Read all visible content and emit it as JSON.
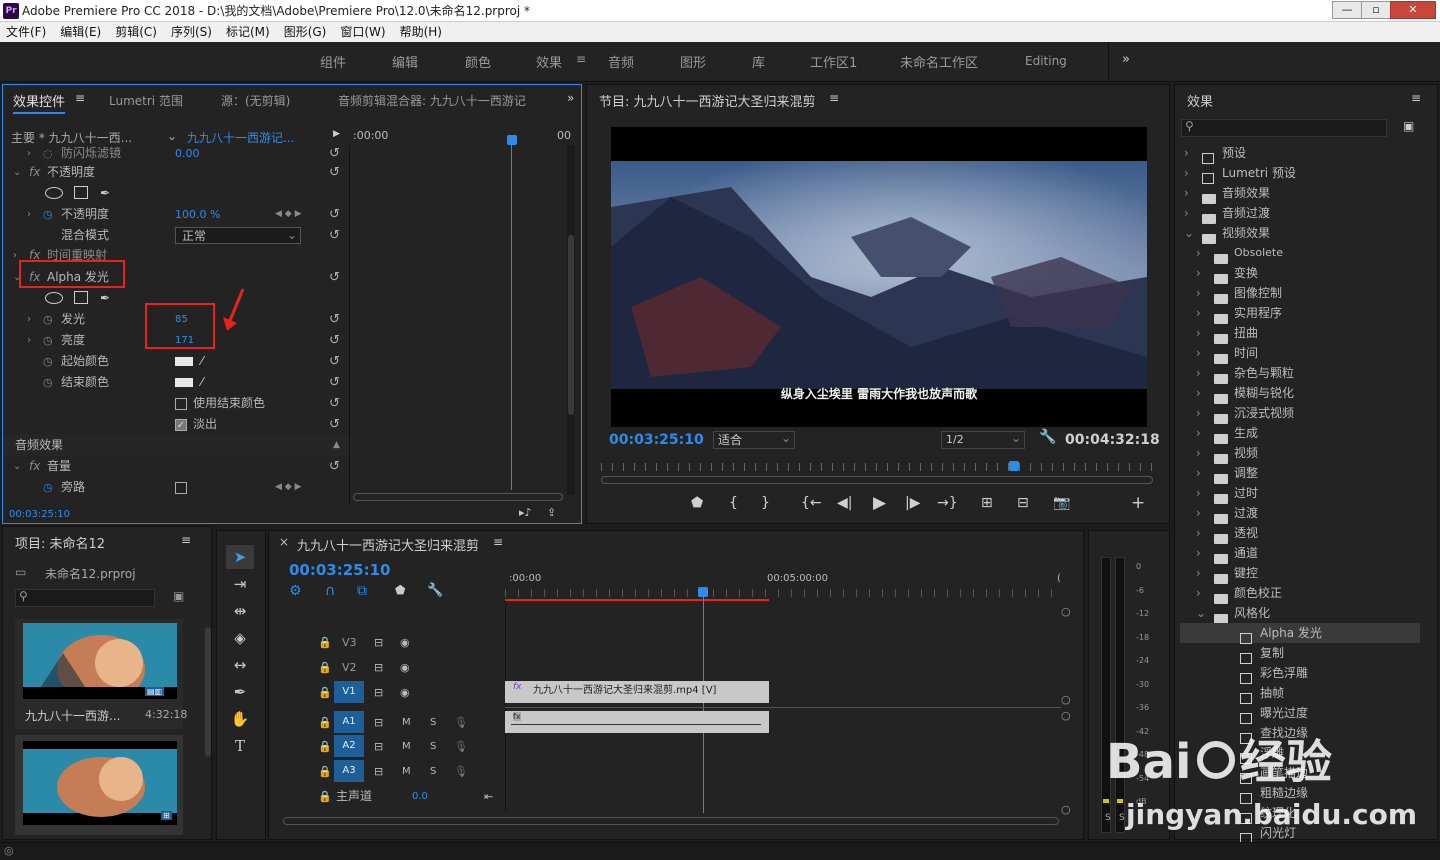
{
  "app": {
    "icon_text": "Pr",
    "title": "Adobe Premiere Pro CC 2018 - D:\\我的文档\\Adobe\\Premiere Pro\\12.0\\未命名12.prproj *"
  },
  "window": {
    "minimize": "—",
    "maximize": "▫",
    "close": "✕"
  },
  "menu": [
    "文件(F)",
    "编辑(E)",
    "剪辑(C)",
    "序列(S)",
    "标记(M)",
    "图形(G)",
    "窗口(W)",
    "帮助(H)"
  ],
  "workspaces": [
    "组件",
    "编辑",
    "颜色",
    "效果",
    "音频",
    "图形",
    "库",
    "工作区1",
    "未命名工作区",
    "Editing"
  ],
  "workspace_active": "效果",
  "effect_controls": {
    "tabs": [
      "效果控件",
      "Lumetri 范围",
      "源：(无剪辑)",
      "音频剪辑混合器: 九九八十一西游记"
    ],
    "master": "主要 * 九九八十一西...",
    "clip": "九九八十一西游记...",
    "tc_start": ":00:00",
    "tc_end": "00",
    "props": {
      "anti_flicker": {
        "label": "防闪烁滤镜",
        "value": "0.00"
      },
      "opacity_group": "不透明度",
      "opacity": {
        "label": "不透明度",
        "value": "100.0 %"
      },
      "blend": {
        "label": "混合模式",
        "value": "正常"
      },
      "time_remap": "时间重映射",
      "alpha_glow": "Alpha 发光",
      "glow": {
        "label": "发光",
        "value": "85"
      },
      "brightness": {
        "label": "亮度",
        "value": "171"
      },
      "start_color": "起始颜色",
      "end_color": "结束颜色",
      "use_end_color": "使用结束颜色",
      "fade_out": "淡出",
      "audio_effects": "音频效果",
      "volume": "音量",
      "bypass": "旁路"
    },
    "timecode": "00:03:25:10"
  },
  "program": {
    "title": "节目: 九九八十一西游记大圣归来混剪",
    "subtitle": "纵身入尘埃里 雷雨大作我也放声而歌",
    "timecode": "00:03:25:10",
    "fit": "适合",
    "res": "1/2",
    "duration": "00:04:32:18"
  },
  "project": {
    "title": "项目: 未命名12",
    "file": "未命名12.prproj",
    "item_name": "九九八十一西游...",
    "item_duration": "4:32:18"
  },
  "timeline": {
    "title": "九九八十一西游记大圣归来混剪",
    "timecode": "00:03:25:10",
    "ruler": [
      ":00:00",
      "00:05:00:00"
    ],
    "tracks_video": [
      "V3",
      "V2",
      "V1"
    ],
    "tracks_audio": [
      "A1",
      "A2",
      "A3"
    ],
    "master": "主声道",
    "master_value": "0.0",
    "clip_video": "九九八十一西游记大圣归来混剪.mp4 [V]",
    "clip_audio": "fx",
    "m_label": "M",
    "s_label": "S"
  },
  "effects": {
    "title": "效果",
    "items": [
      {
        "label": "预设",
        "indent": 0,
        "kind": "preset",
        "open": false
      },
      {
        "label": "Lumetri 预设",
        "indent": 0,
        "kind": "preset",
        "open": false
      },
      {
        "label": "音频效果",
        "indent": 0,
        "kind": "folder",
        "open": false
      },
      {
        "label": "音频过渡",
        "indent": 0,
        "kind": "folder",
        "open": false
      },
      {
        "label": "视频效果",
        "indent": 0,
        "kind": "folder",
        "open": true
      },
      {
        "label": "Obsolete",
        "indent": 1,
        "kind": "folder",
        "open": false
      },
      {
        "label": "变换",
        "indent": 1,
        "kind": "folder",
        "open": false
      },
      {
        "label": "图像控制",
        "indent": 1,
        "kind": "folder",
        "open": false
      },
      {
        "label": "实用程序",
        "indent": 1,
        "kind": "folder",
        "open": false
      },
      {
        "label": "扭曲",
        "indent": 1,
        "kind": "folder",
        "open": false
      },
      {
        "label": "时间",
        "indent": 1,
        "kind": "folder",
        "open": false
      },
      {
        "label": "杂色与颗粒",
        "indent": 1,
        "kind": "folder",
        "open": false
      },
      {
        "label": "模糊与锐化",
        "indent": 1,
        "kind": "folder",
        "open": false
      },
      {
        "label": "沉浸式视频",
        "indent": 1,
        "kind": "folder",
        "open": false
      },
      {
        "label": "生成",
        "indent": 1,
        "kind": "folder",
        "open": false
      },
      {
        "label": "视频",
        "indent": 1,
        "kind": "folder",
        "open": false
      },
      {
        "label": "调整",
        "indent": 1,
        "kind": "folder",
        "open": false
      },
      {
        "label": "过时",
        "indent": 1,
        "kind": "folder",
        "open": false
      },
      {
        "label": "过渡",
        "indent": 1,
        "kind": "folder",
        "open": false
      },
      {
        "label": "透视",
        "indent": 1,
        "kind": "folder",
        "open": false
      },
      {
        "label": "通道",
        "indent": 1,
        "kind": "folder",
        "open": false
      },
      {
        "label": "键控",
        "indent": 1,
        "kind": "folder",
        "open": false
      },
      {
        "label": "颜色校正",
        "indent": 1,
        "kind": "folder",
        "open": false
      },
      {
        "label": "风格化",
        "indent": 1,
        "kind": "folder",
        "open": true
      },
      {
        "label": "Alpha 发光",
        "indent": 2,
        "kind": "preset",
        "open": false,
        "selected": true
      },
      {
        "label": "复制",
        "indent": 2,
        "kind": "preset",
        "open": false
      },
      {
        "label": "彩色浮雕",
        "indent": 2,
        "kind": "preset",
        "open": false
      },
      {
        "label": "抽帧",
        "indent": 2,
        "kind": "preset",
        "open": false
      },
      {
        "label": "曝光过度",
        "indent": 2,
        "kind": "preset",
        "open": false
      },
      {
        "label": "查找边缘",
        "indent": 2,
        "kind": "preset",
        "open": false
      },
      {
        "label": "浮雕",
        "indent": 2,
        "kind": "preset",
        "open": false
      },
      {
        "label": "画笔描边",
        "indent": 2,
        "kind": "preset",
        "open": false
      },
      {
        "label": "粗糙边缘",
        "indent": 2,
        "kind": "preset",
        "open": false
      },
      {
        "label": "纹理化",
        "indent": 2,
        "kind": "preset",
        "open": false
      },
      {
        "label": "闪光灯",
        "indent": 2,
        "kind": "preset",
        "open": false
      }
    ]
  },
  "meter": {
    "ticks": [
      "0",
      "-6",
      "-12",
      "-18",
      "-24",
      "-30",
      "-36",
      "-42",
      "-48",
      "-54",
      "dB"
    ]
  },
  "watermark": "Bai经验 jingyan.baidu.com"
}
